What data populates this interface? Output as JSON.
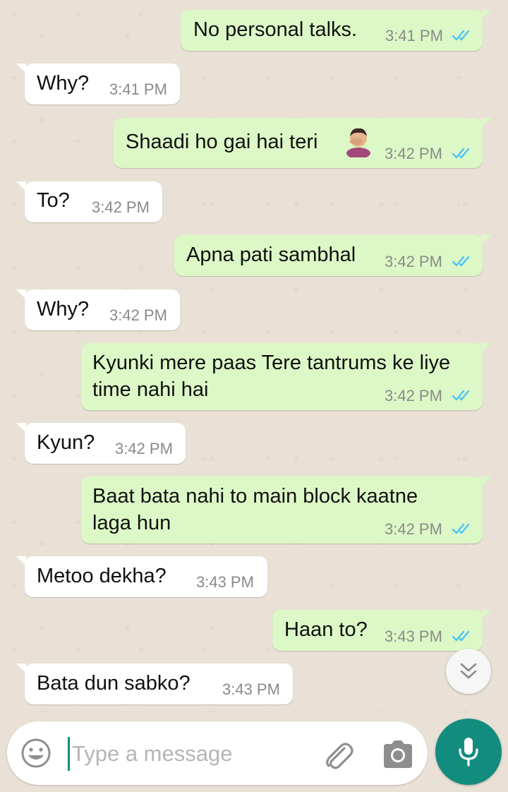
{
  "messages": [
    {
      "direction": "outgoing",
      "text": "No personal talks.",
      "time": "3:41 PM",
      "status": "read"
    },
    {
      "direction": "incoming",
      "text": "Why?",
      "time": "3:41 PM"
    },
    {
      "direction": "outgoing",
      "text": "Shaadi ho gai hai teri",
      "emoji": "face-palm-icon",
      "time": "3:42 PM",
      "status": "read"
    },
    {
      "direction": "incoming",
      "text": "To?",
      "time": "3:42 PM"
    },
    {
      "direction": "outgoing",
      "text": "Apna pati sambhal",
      "time": "3:42 PM",
      "status": "read"
    },
    {
      "direction": "incoming",
      "text": "Why?",
      "time": "3:42 PM"
    },
    {
      "direction": "outgoing",
      "text": "Kyunki mere paas Tere tantrums ke liye time nahi hai",
      "time": "3:42 PM",
      "status": "read"
    },
    {
      "direction": "incoming",
      "text": "Kyun?",
      "time": "3:42 PM"
    },
    {
      "direction": "outgoing",
      "text": "Baat bata nahi to main block kaatne laga hun",
      "time": "3:42 PM",
      "status": "read"
    },
    {
      "direction": "incoming",
      "text": "Metoo dekha?",
      "time": "3:43 PM"
    },
    {
      "direction": "outgoing",
      "text": "Haan to?",
      "time": "3:43 PM",
      "status": "read"
    },
    {
      "direction": "incoming",
      "text": "Bata dun sabko?",
      "time": "3:43 PM"
    }
  ],
  "composer": {
    "placeholder": "Type a message",
    "emoji_icon": "emoji-icon",
    "attach_icon": "paperclip-icon",
    "camera_icon": "camera-icon",
    "mic_icon": "microphone-icon"
  },
  "scroll_button_icon": "double-chevron-down-icon",
  "colors": {
    "chat_background": "#e9e1d6",
    "outgoing_bubble": "#dcf8c6",
    "incoming_bubble": "#ffffff",
    "read_ticks": "#4fc3f7",
    "accent": "#128c7e"
  }
}
